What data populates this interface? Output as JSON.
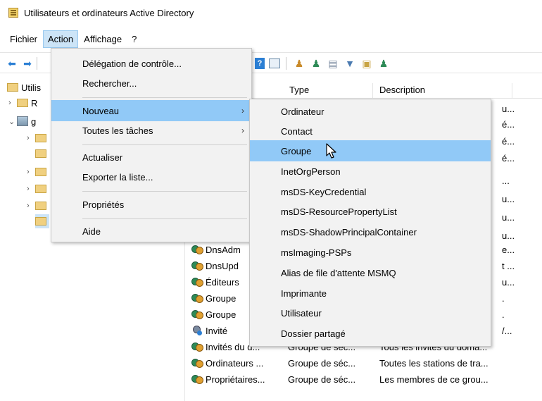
{
  "window": {
    "title": "Utilisateurs et ordinateurs Active Directory"
  },
  "menubar": {
    "items": [
      "Fichier",
      "Action",
      "Affichage",
      "?"
    ],
    "active": "Action"
  },
  "tree": {
    "root_label": "Utilis",
    "items": [
      {
        "label": "R"
      },
      {
        "label": "g"
      }
    ]
  },
  "list": {
    "columns": {
      "type": "Type",
      "description": "Description"
    },
    "rows": [
      {
        "icon": "group-icon",
        "name": "DnsAdm",
        "type": "",
        "description": "e..."
      },
      {
        "icon": "group-icon",
        "name": "DnsUpd",
        "type": "",
        "description": "t ..."
      },
      {
        "icon": "group-icon",
        "name": "Éditeurs",
        "type": "",
        "description": "u..."
      },
      {
        "icon": "group-icon",
        "name": "Groupe",
        "type": "",
        "description": "."
      },
      {
        "icon": "group-icon",
        "name": "Groupe",
        "type": "",
        "description": "."
      },
      {
        "icon": "user-icon",
        "name": "Invité",
        "type": "",
        "description": "/..."
      },
      {
        "icon": "group-icon",
        "name": "Invités du d...",
        "type": "Groupe de séc...",
        "description": "Tous les invités du doma..."
      },
      {
        "icon": "group-icon",
        "name": "Ordinateurs ...",
        "type": "Groupe de séc...",
        "description": "Toutes les stations de tra..."
      },
      {
        "icon": "group-icon",
        "name": "Propriétaires...",
        "type": "Groupe de séc...",
        "description": "Les membres de ce grou..."
      }
    ],
    "upper_desc_fragments": [
      "u...",
      "é...",
      "é...",
      "é...",
      "...",
      "u...",
      "u...",
      "u..."
    ]
  },
  "action_menu": {
    "items": [
      {
        "label": "Délégation de contrôle...",
        "submenu": false
      },
      {
        "label": "Rechercher...",
        "submenu": false
      },
      {
        "label": "Nouveau",
        "submenu": true,
        "highlighted": true
      },
      {
        "label": "Toutes les tâches",
        "submenu": true
      },
      {
        "label": "Actualiser",
        "submenu": false
      },
      {
        "label": "Exporter la liste...",
        "submenu": false
      },
      {
        "label": "Propriétés",
        "submenu": false
      },
      {
        "label": "Aide",
        "submenu": false
      }
    ]
  },
  "new_submenu": {
    "items": [
      {
        "label": "Ordinateur"
      },
      {
        "label": "Contact"
      },
      {
        "label": "Groupe",
        "highlighted": true
      },
      {
        "label": "InetOrgPerson"
      },
      {
        "label": "msDS-KeyCredential"
      },
      {
        "label": "msDS-ResourcePropertyList"
      },
      {
        "label": "msDS-ShadowPrincipalContainer"
      },
      {
        "label": "msImaging-PSPs"
      },
      {
        "label": "Alias de file d'attente MSMQ"
      },
      {
        "label": "Imprimante"
      },
      {
        "label": "Utilisateur"
      },
      {
        "label": "Dossier partagé"
      }
    ]
  },
  "colors": {
    "highlight": "#91c9f7",
    "menu_bg": "#f2f2f2",
    "menubar_active": "#cce4f7"
  }
}
